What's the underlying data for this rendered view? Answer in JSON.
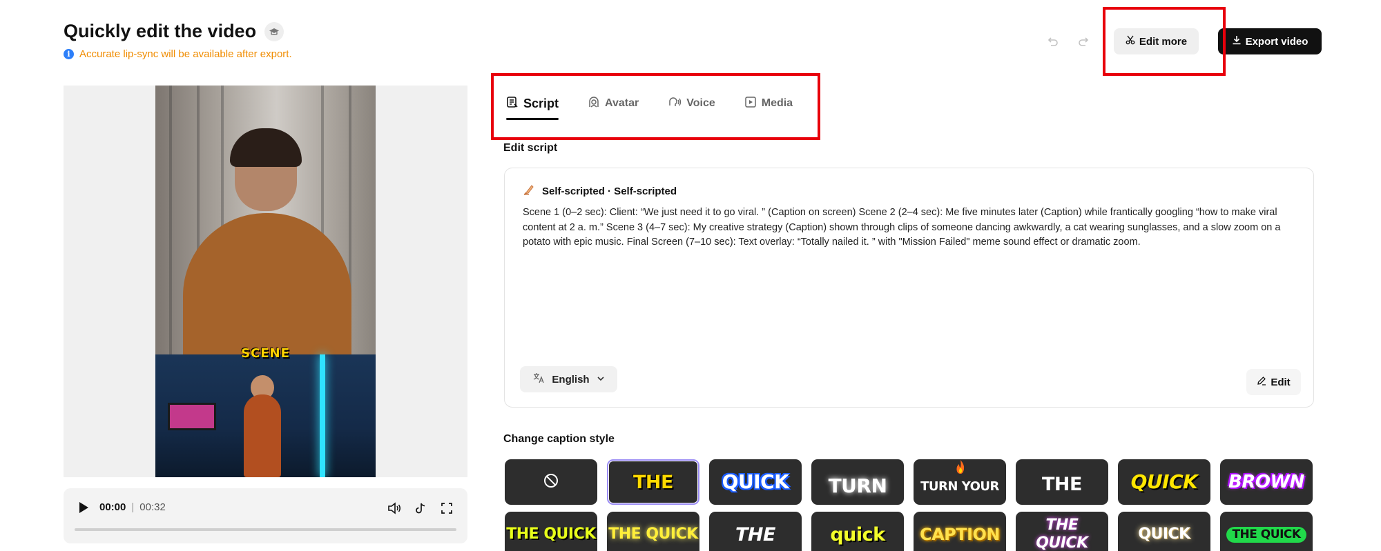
{
  "header": {
    "title": "Quickly edit the video",
    "notice": "Accurate lip-sync will be available after export.",
    "edit_more": "Edit more",
    "export": "Export video"
  },
  "preview": {
    "caption": "SCENE"
  },
  "player": {
    "current_time": "00:00",
    "separator": "|",
    "duration": "00:32",
    "progress": 0
  },
  "tabs": [
    {
      "label": "Script",
      "icon": "script-icon",
      "active": true
    },
    {
      "label": "Avatar",
      "icon": "avatar-icon",
      "active": false
    },
    {
      "label": "Voice",
      "icon": "voice-icon",
      "active": false
    },
    {
      "label": "Media",
      "icon": "media-icon",
      "active": false
    }
  ],
  "script": {
    "section_label": "Edit script",
    "source_label": "Self-scripted · Self-scripted",
    "text": "Scene 1 (0–2 sec): Client: “We just need it to go viral. ” (Caption on screen) Scene 2 (2–4 sec): Me five minutes later (Caption) while frantically googling “how to make viral content at 2 a. m.” Scene 3 (4–7 sec): My creative strategy (Caption) shown through clips of someone dancing awkwardly, a cat wearing sunglasses, and a slow zoom on a potato with epic music. Final Screen (7–10 sec): Text overlay: “Totally nailed it. ” with \"Mission Failed\" meme sound effect or dramatic zoom.",
    "language": "English",
    "edit_label": "Edit"
  },
  "caption_styles": {
    "section_label": "Change caption style",
    "row1": [
      "",
      "THE",
      "QUICK",
      "TURN",
      "TURN YOUR",
      "THE",
      "QUICK",
      "BROWN"
    ],
    "row2": [
      "THE QUICK",
      "THE QUICK",
      "THE",
      "quick",
      "CAPTION",
      "THE QUICK",
      "QUICK",
      "THE QUICK"
    ],
    "selected_index": 1
  },
  "colors": {
    "highlight": "#e8000b",
    "notice": "#f08c00",
    "info": "#2d7ff9",
    "primary_button": "#111111"
  }
}
